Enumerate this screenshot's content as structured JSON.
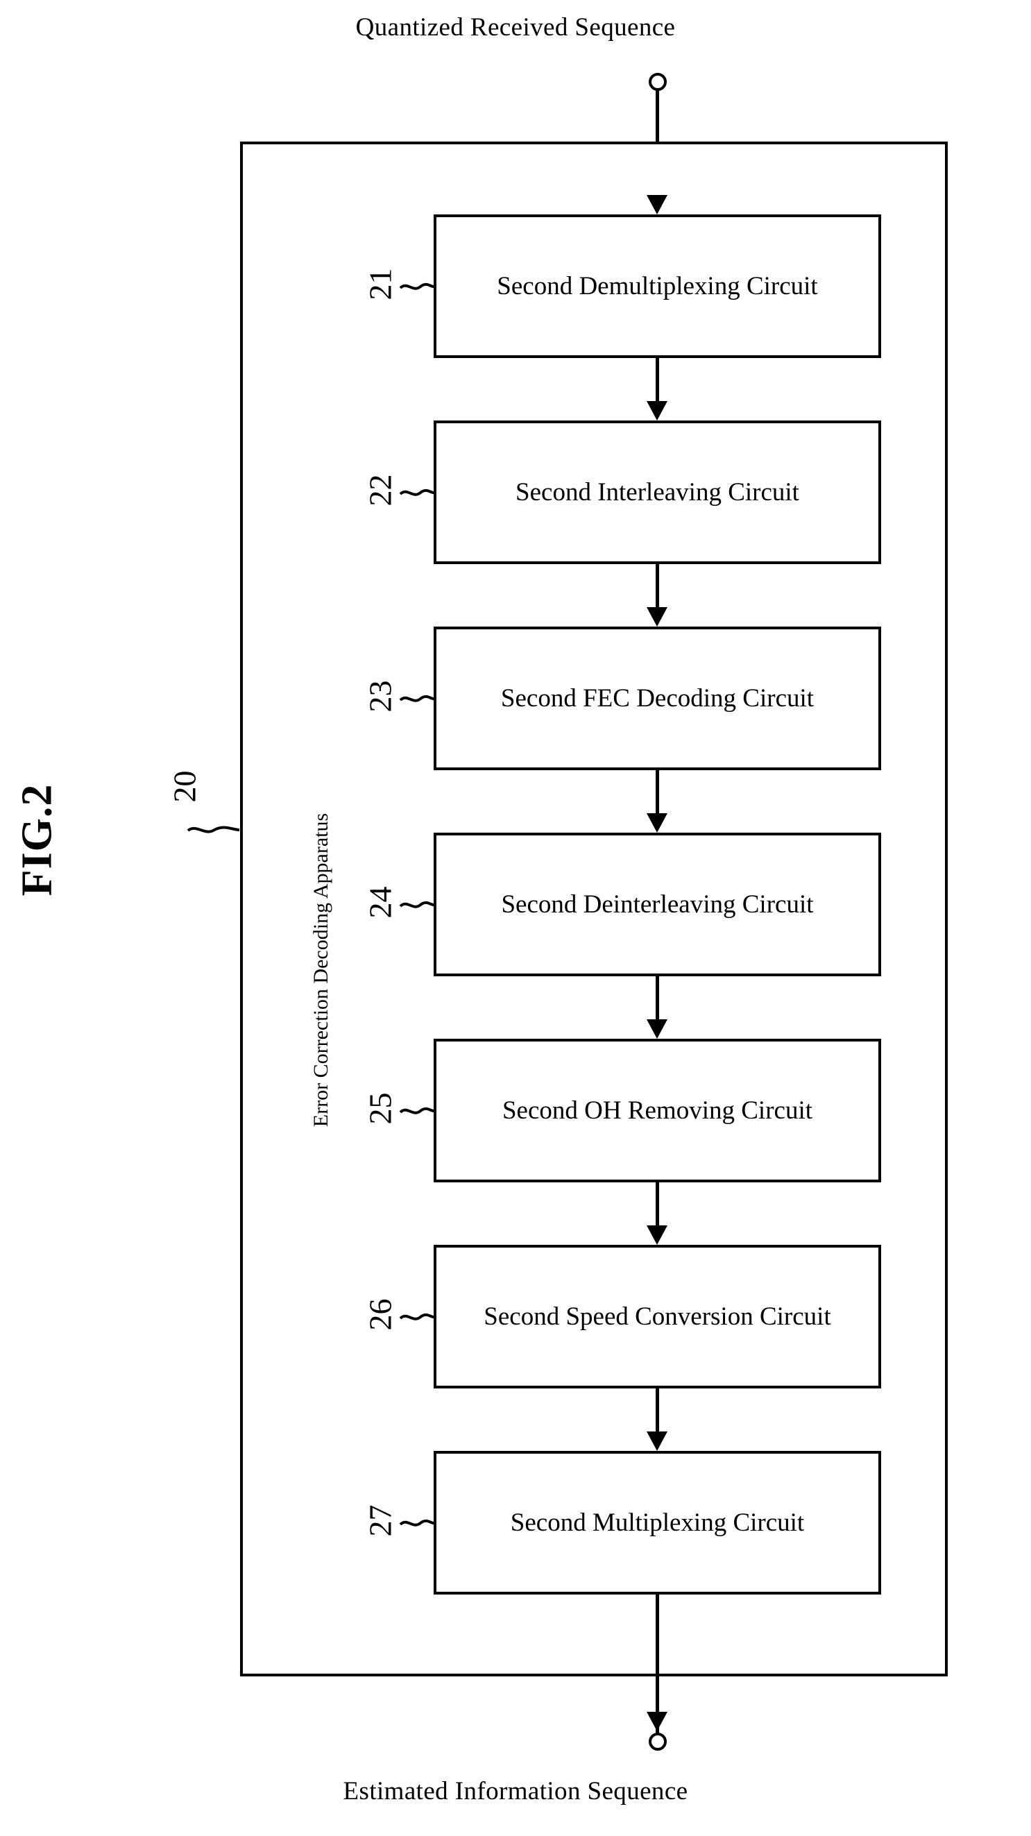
{
  "figure": {
    "title": "FIG.2",
    "input_caption": "Quantized Received Sequence",
    "output_caption": "Estimated Information Sequence",
    "apparatus_label": "Error Correction Decoding Apparatus",
    "apparatus_ref": "20"
  },
  "blocks": [
    {
      "ref": "21",
      "label": "Second Demultiplexing Circuit"
    },
    {
      "ref": "22",
      "label": "Second Interleaving Circuit"
    },
    {
      "ref": "23",
      "label": "Second FEC Decoding Circuit"
    },
    {
      "ref": "24",
      "label": "Second Deinterleaving Circuit"
    },
    {
      "ref": "25",
      "label": "Second OH Removing Circuit"
    },
    {
      "ref": "26",
      "label": "Second Speed Conversion Circuit"
    },
    {
      "ref": "27",
      "label": "Second Multiplexing Circuit"
    }
  ],
  "colors": {
    "ink": "#000000",
    "paper": "#ffffff"
  }
}
